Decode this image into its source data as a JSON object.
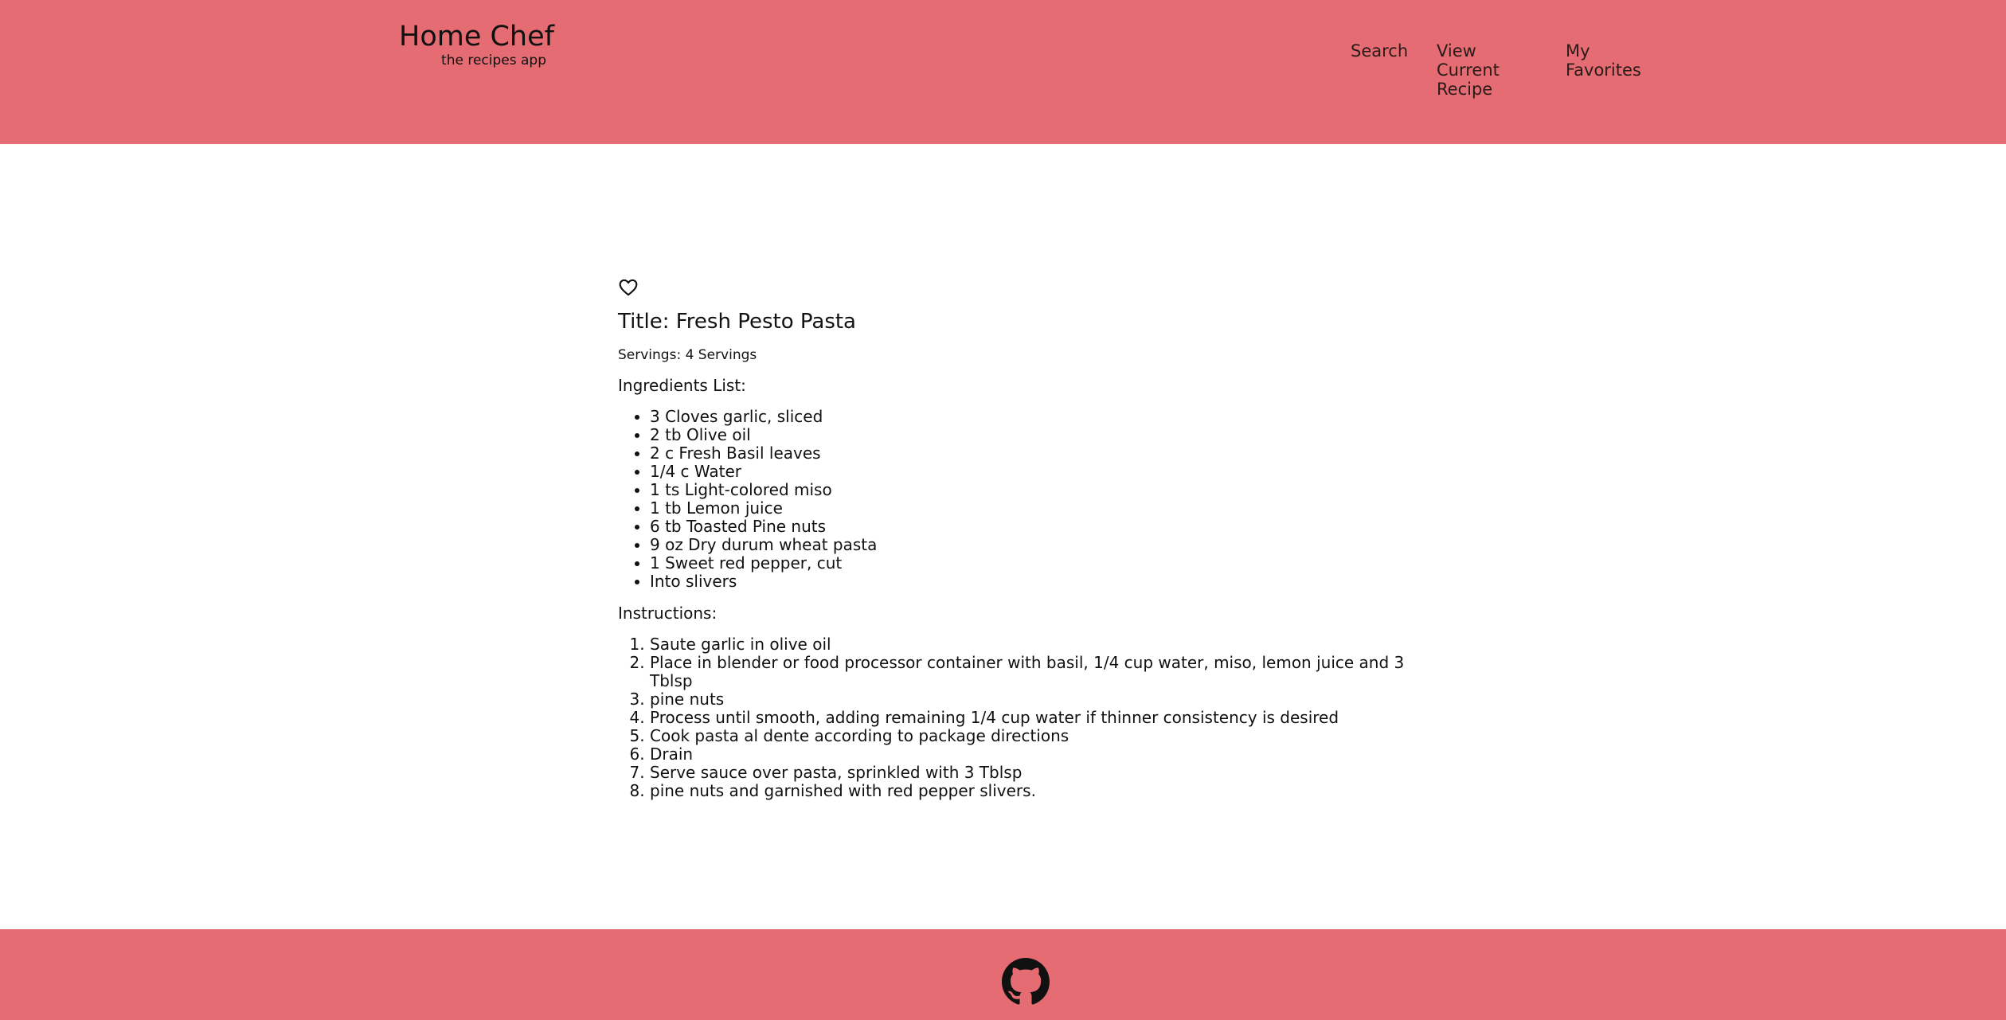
{
  "header": {
    "app_title": "Home Chef",
    "app_subtitle": "the recipes app",
    "nav": {
      "search": "Search",
      "view_current_recipe": "View Current Recipe",
      "my_favorites": "My Favorites"
    },
    "background_color": "#e46c72"
  },
  "recipe": {
    "favorite_icon": "heart-outline-icon",
    "title": "Title: Fresh Pesto Pasta",
    "servings": "Servings: 4 Servings",
    "ingredients_label": "Ingredients List:",
    "ingredients": [
      "3 Cloves garlic, sliced",
      "2 tb Olive oil",
      "2 c Fresh Basil leaves",
      "1/4 c Water",
      "1 ts Light-colored miso",
      "1 tb Lemon juice",
      "6 tb Toasted Pine nuts",
      "9 oz Dry durum wheat pasta",
      "1 Sweet red pepper, cut",
      "Into slivers"
    ],
    "instructions_label": "Instructions:",
    "instructions": [
      "Saute garlic in olive oil",
      "Place in blender or food processor container with basil, 1/4 cup water, miso, lemon juice and 3 Tblsp",
      "pine nuts",
      "Process until smooth, adding remaining 1/4 cup water if thinner consistency is desired",
      "Cook pasta al dente according to package directions",
      "Drain",
      "Serve sauce over pasta, sprinkled with 3 Tblsp",
      "pine nuts and garnished with red pepper slivers."
    ]
  },
  "footer": {
    "icon": "github-icon",
    "background_color": "#e46c72"
  }
}
